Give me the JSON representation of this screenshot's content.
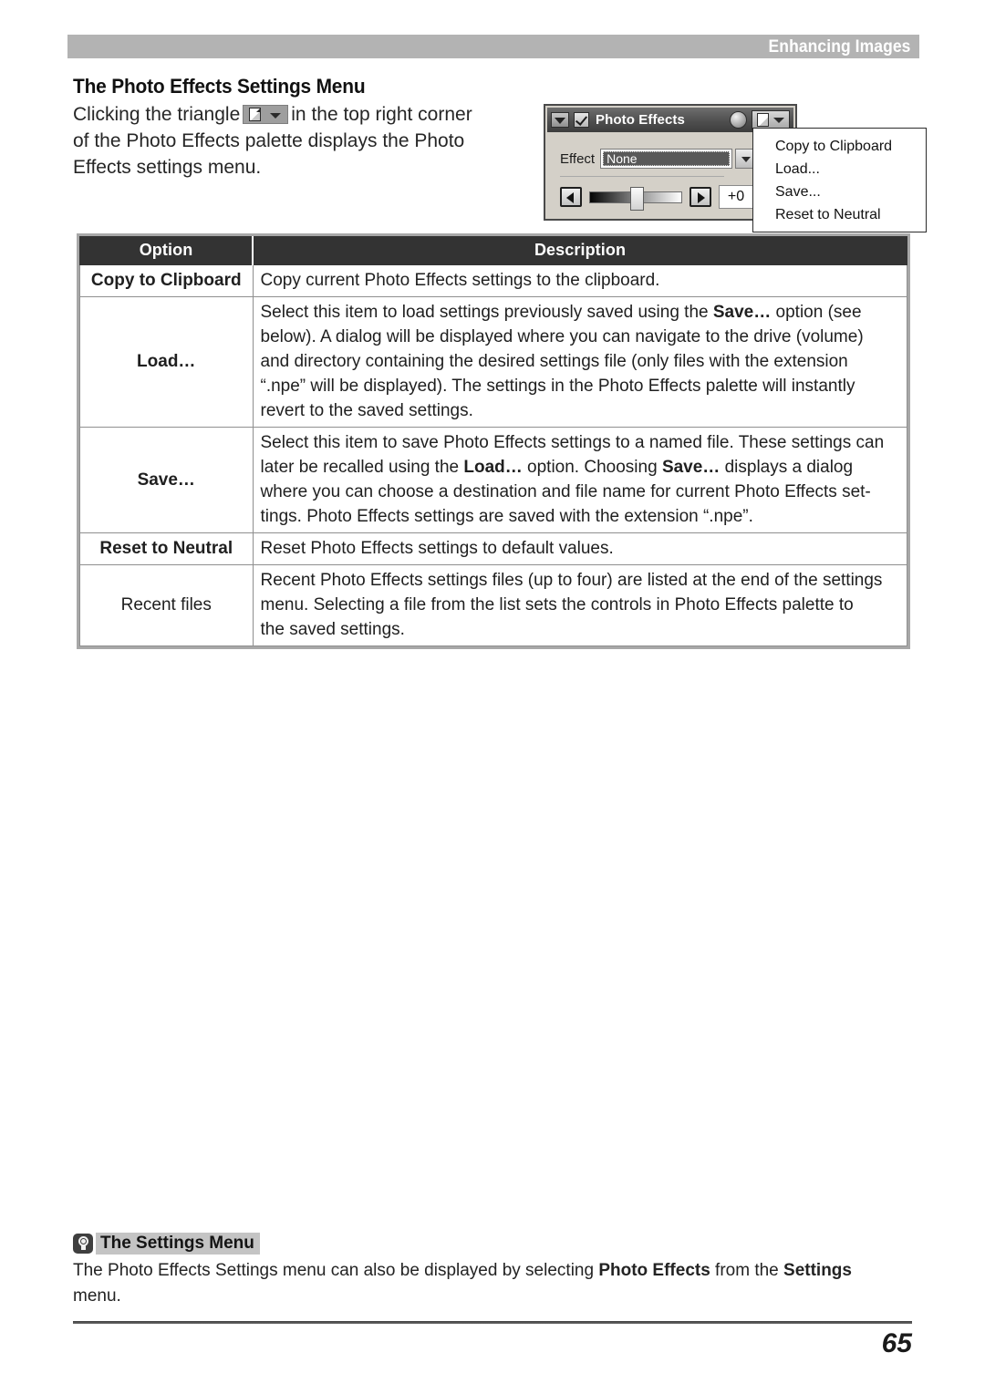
{
  "running_head": {
    "text": "Enhancing Images"
  },
  "page": {
    "number": "65"
  },
  "section": {
    "title": "The Photo Effects Settings Menu"
  },
  "intro": {
    "line1_before": "Clicking the triangle",
    "icon": "page-dropdown-icon",
    "line1_after": "in the top right corner",
    "line2": "of the Photo Effects palette displays the Photo",
    "line3": "Effects settings menu."
  },
  "palette": {
    "title": "Photo Effects",
    "collapse_icon": "collapse-triangle-icon",
    "enabled_checkbox": "checked-checkbox-icon",
    "knob_icon": "circle-knob-icon",
    "menu_button_icon": "page-dropdown-icon",
    "effect_label": "Effect",
    "effect_value": "None",
    "slider_value": "+0",
    "prev_icon": "left-arrow-icon",
    "next_icon": "right-arrow-icon",
    "menu_items": [
      "Copy to Clipboard",
      "Load...",
      "Save...",
      "Reset to Neutral"
    ]
  },
  "table": {
    "headers": {
      "option": "Option",
      "description": "Description"
    },
    "rows": [
      {
        "option": "Copy to Clipboard",
        "option_bold": true,
        "desc_lines": [
          "Copy current Photo Effects settings to the clipboard."
        ]
      },
      {
        "option": "Load…",
        "option_bold": true,
        "desc_lines": [
          {
            "pre": "Select this item to load settings previously saved using the ",
            "bold": "Save…",
            "post": " option (see"
          },
          {
            "pre": "below).  A dialog will be displayed where you can navigate to the drive (volume)"
          },
          {
            "pre": "and directory containing the desired settings file (only files with the extension"
          },
          {
            "pre": "“.npe” will be displayed).  The settings in the Photo Effects palette will instantly"
          },
          {
            "pre": "revert to the saved settings."
          }
        ]
      },
      {
        "option": "Save…",
        "option_bold": true,
        "desc_lines": [
          {
            "pre": "Select this item to save Photo Effects settings to a named file.  These settings can"
          },
          {
            "pre": "later be recalled using the ",
            "bold": "Load…",
            "post": " option.  Choosing ",
            "bold2": "Save…",
            "post2": " displays a dialog"
          },
          {
            "pre": "where you can choose a destination and file name for current Photo Effects set-"
          },
          {
            "pre": "tings.  Photo Effects settings are saved with the extension “.npe”."
          }
        ]
      },
      {
        "option": "Reset to Neutral",
        "option_bold": true,
        "desc_lines": [
          "Reset Photo Effects settings to default values."
        ]
      },
      {
        "option": "Recent files",
        "option_bold": false,
        "desc_lines": [
          {
            "pre": "Recent Photo Effects settings files (up to four) are listed at the end of the settings"
          },
          {
            "pre": "menu.  Selecting a file from the list sets the controls in Photo Effects palette to"
          },
          {
            "pre": "the saved settings."
          }
        ]
      }
    ]
  },
  "tip": {
    "icon": "lightbulb-tip-icon",
    "title": "The Settings Menu",
    "line1_pre": "The Photo Effects Settings menu can also be displayed by selecting ",
    "line1_bold": "Photo Effects",
    "line1_mid": " from the ",
    "line1_bold2": "Settings",
    "line2": "menu."
  }
}
